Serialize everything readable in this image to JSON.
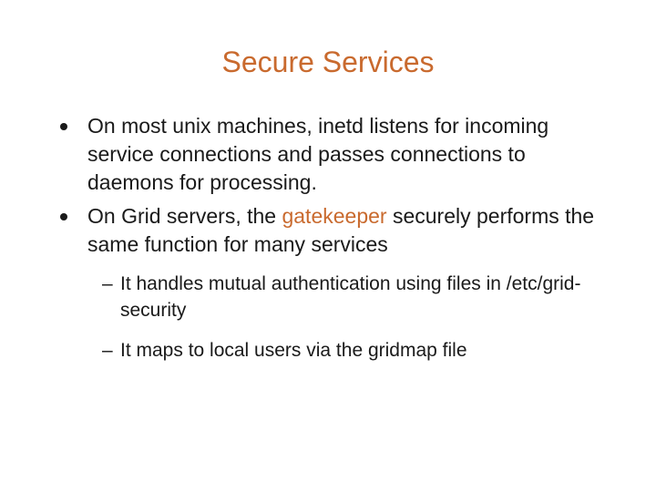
{
  "title": "Secure Services",
  "bullets": [
    {
      "text": "On most unix machines, inetd listens for incoming service connections and passes connections to daemons for processing."
    },
    {
      "prefix": "On Grid servers, the ",
      "highlight": "gatekeeper",
      "suffix": " securely performs the same function for many services"
    }
  ],
  "subitems": [
    "It handles mutual authentication using files in /etc/grid-security",
    "It maps to local users via the gridmap file"
  ]
}
